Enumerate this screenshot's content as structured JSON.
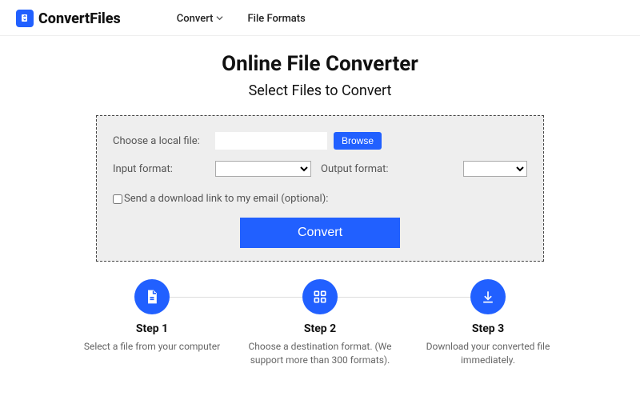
{
  "brand": {
    "name": "ConvertFiles"
  },
  "nav": {
    "convert": "Convert",
    "formats": "File Formats"
  },
  "hero": {
    "title": "Online File Converter",
    "subtitle": "Select Files to Convert"
  },
  "panel": {
    "choose_label": "Choose a local file:",
    "browse": "Browse",
    "input_format_label": "Input format:",
    "output_format_label": "Output format:",
    "email_checkbox_label": "Send a download link to my email (optional):",
    "convert_button": "Convert"
  },
  "steps": {
    "items": [
      {
        "title": "Step 1",
        "desc": "Select a file from your computer"
      },
      {
        "title": "Step 2",
        "desc": "Choose a destination format. (We support more than 300 formats)."
      },
      {
        "title": "Step 3",
        "desc": "Download your converted file immediately."
      }
    ]
  }
}
